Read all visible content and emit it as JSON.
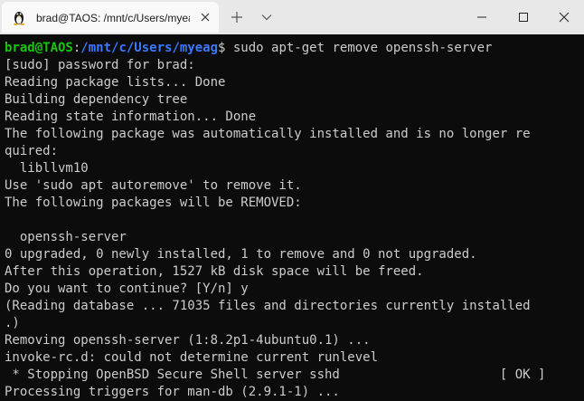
{
  "tab": {
    "title": "brad@TAOS: /mnt/c/Users/myeag"
  },
  "prompt": {
    "user_host": "brad@TAOS",
    "separator": ":",
    "path": "/mnt/c/Users/myeag",
    "symbol": "$",
    "command": " sudo apt-get remove openssh-server"
  },
  "terminal": {
    "lines": [
      "[sudo] password for brad:",
      "Reading package lists... Done",
      "Building dependency tree",
      "Reading state information... Done",
      "The following package was automatically installed and is no longer re",
      "quired:",
      "  libllvm10",
      "Use 'sudo apt autoremove' to remove it.",
      "The following packages will be REMOVED:",
      "",
      "  openssh-server",
      "0 upgraded, 0 newly installed, 1 to remove and 0 not upgraded.",
      "After this operation, 1527 kB disk space will be freed.",
      "Do you want to continue? [Y/n] y",
      "(Reading database ... 71035 files and directories currently installed",
      ".)",
      "Removing openssh-server (1:8.2p1-4ubuntu0.1) ...",
      "invoke-rc.d: could not determine current runlevel",
      " * Stopping OpenBSD Secure Shell server sshd                     [ OK ]",
      "Processing triggers for man-db (2.9.1-1) ..."
    ]
  },
  "colors": {
    "background": "#0c0c0c",
    "text": "#cccccc",
    "prompt_user": "#16c60c",
    "prompt_path": "#3b78ff"
  }
}
